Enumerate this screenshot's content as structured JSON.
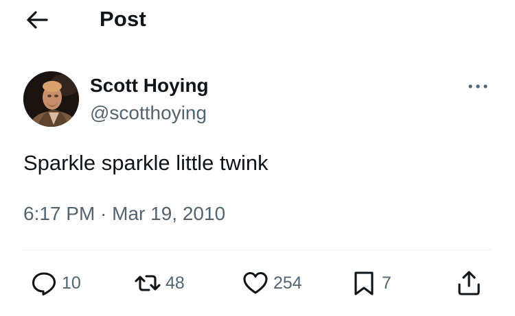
{
  "header": {
    "title": "Post",
    "back_icon": "arrow-left-icon"
  },
  "post": {
    "author": {
      "display_name": "Scott Hoying",
      "handle": "@scotthoying"
    },
    "more_icon": "more-horizontal-icon",
    "text": "Sparkle sparkle little twink",
    "timestamp": "6:17 PM · Mar 19, 2010",
    "actions": {
      "replies": "10",
      "reposts": "48",
      "likes": "254",
      "bookmarks": "7"
    }
  },
  "colors": {
    "text_primary": "#0f1419",
    "text_secondary": "#536471",
    "divider": "#eff3f4"
  }
}
